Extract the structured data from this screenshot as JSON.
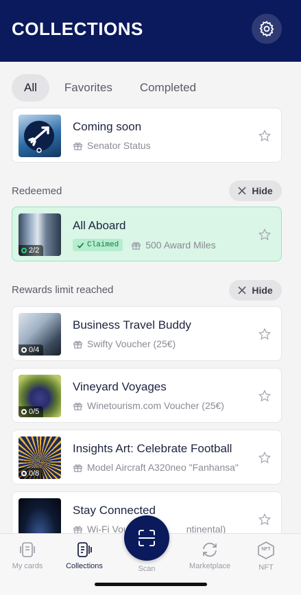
{
  "header": {
    "title": "COLLECTIONS",
    "settings_icon": "gear-icon"
  },
  "tabs": [
    {
      "label": "All",
      "active": true
    },
    {
      "label": "Favorites",
      "active": false
    },
    {
      "label": "Completed",
      "active": false
    }
  ],
  "pinned": [
    {
      "name": "Coming soon",
      "reward": "Senator Status",
      "favorite": false
    }
  ],
  "redeemed": {
    "label": "Redeemed",
    "hide_label": "Hide",
    "items": [
      {
        "name": "All Aboard",
        "status": "Claimed",
        "progress": "2/2",
        "reward": "500 Award Miles",
        "favorite": false
      }
    ]
  },
  "limit_reached": {
    "label": "Rewards limit reached",
    "hide_label": "Hide",
    "items": [
      {
        "name": "Business Travel Buddy",
        "progress": "0/4",
        "reward": "Swifty Voucher (25€)",
        "favorite": false
      },
      {
        "name": "Vineyard Voyages",
        "progress": "0/5",
        "reward": "Winetourism.com Voucher (25€)",
        "favorite": false
      },
      {
        "name": "Insights Art: Celebrate Football",
        "progress": "0/8",
        "reward": "Model Aircraft A320neo \"Fanhansa\"",
        "favorite": false
      },
      {
        "name": "Stay Connected",
        "progress": "",
        "reward": "Wi-Fi Vou",
        "reward_tail": "ntinental)",
        "favorite": false
      }
    ]
  },
  "tabbar": {
    "my_cards": "My cards",
    "collections": "Collections",
    "scan": "Scan",
    "marketplace": "Marketplace",
    "nft": "NFT",
    "nft_icon_text": "NFT"
  },
  "colors": {
    "brand_navy": "#0b1a5c",
    "claimed_green": "#d9f6e6"
  }
}
